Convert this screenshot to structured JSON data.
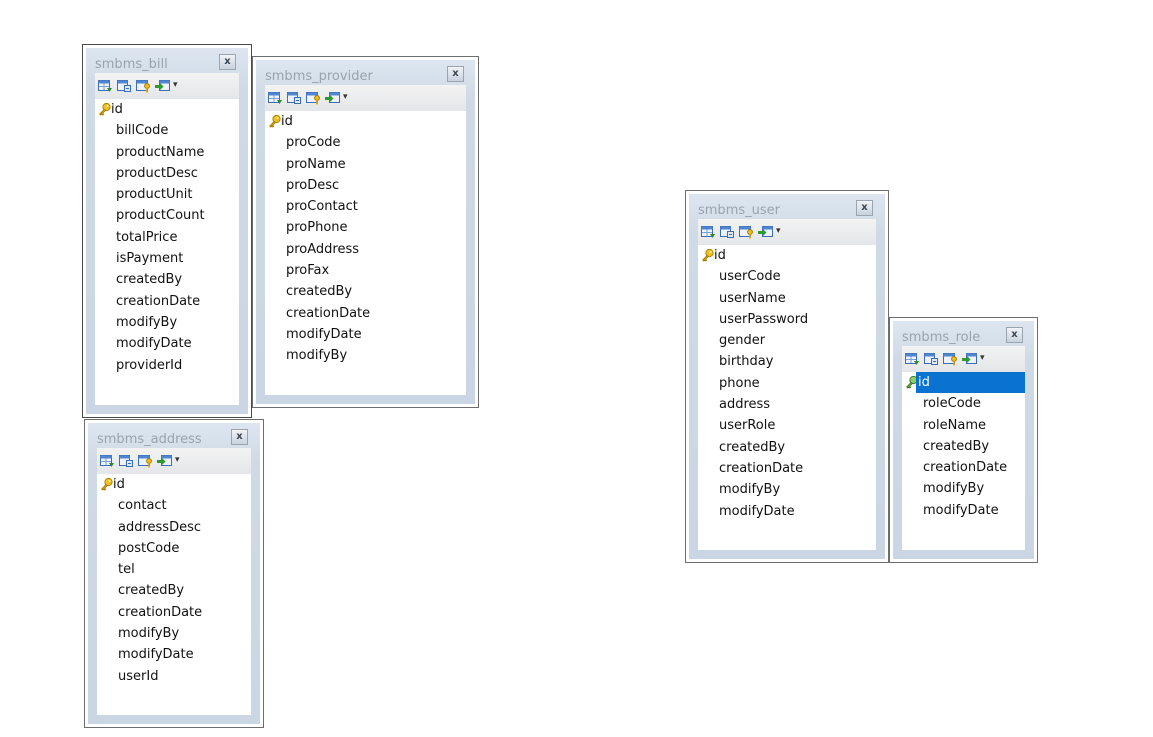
{
  "colors": {
    "selection": "#0a72d0",
    "frame": "#cad6e3",
    "title": "#9aa3ad",
    "key": "#e0b020"
  },
  "toolbar": {
    "icons": [
      "add-field-icon",
      "add-index-icon",
      "set-primary-key-icon",
      "insert-field-icon"
    ],
    "dropdown": "▾"
  },
  "close_label": "x",
  "tables": {
    "bill": {
      "name": "smbms_bill",
      "fields": [
        "id",
        "billCode",
        "productName",
        "productDesc",
        "productUnit",
        "productCount",
        "totalPrice",
        "isPayment",
        "createdBy",
        "creationDate",
        "modifyBy",
        "modifyDate",
        "providerId"
      ]
    },
    "provider": {
      "name": "smbms_provider",
      "fields": [
        "id",
        "proCode",
        "proName",
        "proDesc",
        "proContact",
        "proPhone",
        "proAddress",
        "proFax",
        "createdBy",
        "creationDate",
        "modifyDate",
        "modifyBy"
      ]
    },
    "address": {
      "name": "smbms_address",
      "fields": [
        "id",
        "contact",
        "addressDesc",
        "postCode",
        "tel",
        "createdBy",
        "creationDate",
        "modifyBy",
        "modifyDate",
        "userId"
      ]
    },
    "user": {
      "name": "smbms_user",
      "fields": [
        "id",
        "userCode",
        "userName",
        "userPassword",
        "gender",
        "birthday",
        "phone",
        "address",
        "userRole",
        "createdBy",
        "creationDate",
        "modifyBy",
        "modifyDate"
      ]
    },
    "role": {
      "name": "smbms_role",
      "fields": [
        "id",
        "roleCode",
        "roleName",
        "createdBy",
        "creationDate",
        "modifyBy",
        "modifyDate"
      ],
      "selected_field": "id"
    }
  }
}
